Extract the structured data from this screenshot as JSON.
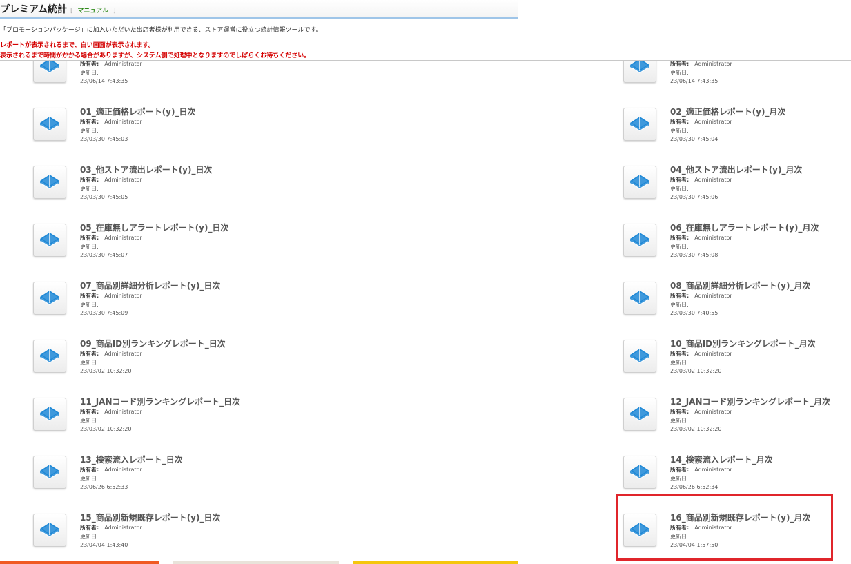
{
  "header": {
    "title": "プレミアム統計",
    "manual_open": "[",
    "manual_link": "マニュアル",
    "manual_close": "]"
  },
  "description": "「プロモーションパッケージ」に加入いただいた出店者様が利用できる、ストア運営に役立つ統計情報ツールです。",
  "warnings": [
    "レポートが表示されるまで、白い画面が表示されます。",
    "表示されるまで時間がかかる場合がありますが、システム側で処理中となりますのでしばらくお待ちください。"
  ],
  "labels": {
    "owner": "所有者:",
    "updated": "更新日:"
  },
  "partial_row": {
    "left": {
      "owner": "Administrator",
      "date": "23/06/14 7:43:35"
    },
    "right": {
      "owner": "Administrator",
      "date": "23/06/14 7:43:35"
    }
  },
  "reports": [
    {
      "name": "01_適正価格レポート(y)_日次",
      "owner": "Administrator",
      "date": "23/03/30 7:45:03"
    },
    {
      "name": "02_適正価格レポート(y)_月次",
      "owner": "Administrator",
      "date": "23/03/30 7:45:04"
    },
    {
      "name": "03_他ストア流出レポート(y)_日次",
      "owner": "Administrator",
      "date": "23/03/30 7:45:05"
    },
    {
      "name": "04_他ストア流出レポート(y)_月次",
      "owner": "Administrator",
      "date": "23/03/30 7:45:06"
    },
    {
      "name": "05_在庫無しアラートレポート(y)_日次",
      "owner": "Administrator",
      "date": "23/03/30 7:45:07"
    },
    {
      "name": "06_在庫無しアラートレポート(y)_月次",
      "owner": "Administrator",
      "date": "23/03/30 7:45:08"
    },
    {
      "name": "07_商品別詳細分析レポート(y)_日次",
      "owner": "Administrator",
      "date": "23/03/30 7:45:09"
    },
    {
      "name": "08_商品別詳細分析レポート(y)_月次",
      "owner": "Administrator",
      "date": "23/03/30 7:40:55"
    },
    {
      "name": "09_商品ID別ランキングレポート_日次",
      "owner": "Administrator",
      "date": "23/03/02 10:32:20"
    },
    {
      "name": "10_商品ID別ランキングレポート_月次",
      "owner": "Administrator",
      "date": "23/03/02 10:32:20"
    },
    {
      "name": "11_JANコード別ランキングレポート_日次",
      "owner": "Administrator",
      "date": "23/03/02 10:32:20"
    },
    {
      "name": "12_JANコード別ランキングレポート_月次",
      "owner": "Administrator",
      "date": "23/03/02 10:32:20"
    },
    {
      "name": "13_検索流入レポート_日次",
      "owner": "Administrator",
      "date": "23/06/26 6:52:33"
    },
    {
      "name": "14_検索流入レポート_月次",
      "owner": "Administrator",
      "date": "23/06/26 6:52:34"
    },
    {
      "name": "15_商品別新規既存レポート(y)_日次",
      "owner": "Administrator",
      "date": "23/04/04 1:43:40"
    },
    {
      "name": "16_商品別新規既存レポート(y)_月次",
      "owner": "Administrator",
      "date": "23/04/04 1:57:50"
    }
  ],
  "icon": "report-book-icon",
  "colors": {
    "warning": "#d40000",
    "highlight": "#e0252b",
    "icon": "#1e88d6",
    "manual": "#2f8a1a"
  }
}
